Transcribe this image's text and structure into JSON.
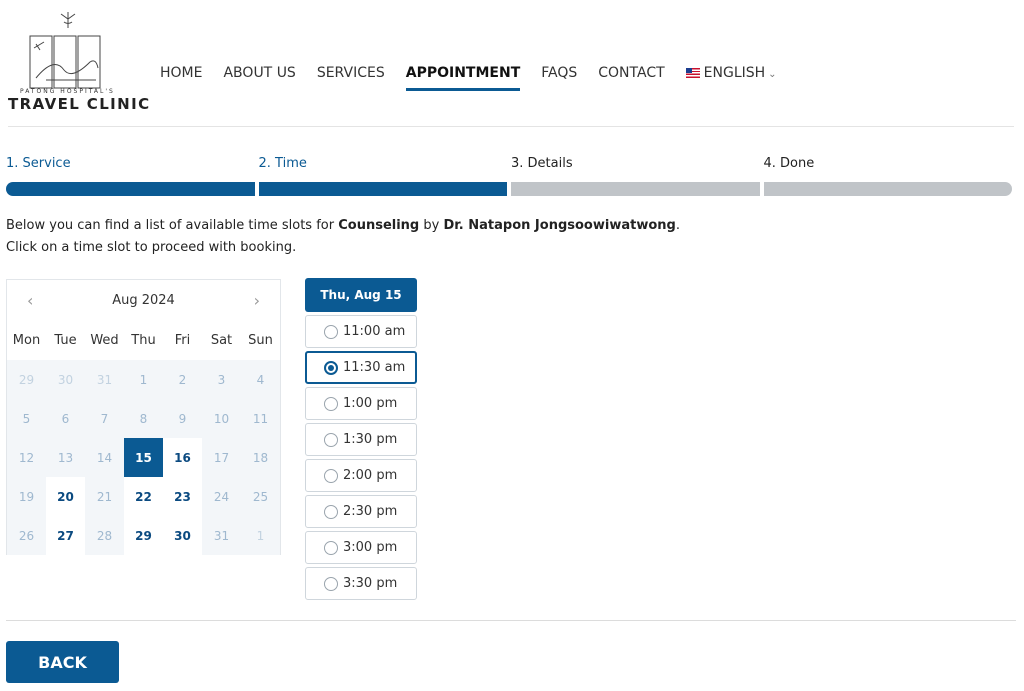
{
  "brand": {
    "small": "PATONG HOSPITAL'S",
    "name": "TRAVEL CLINIC"
  },
  "nav": {
    "items": [
      "HOME",
      "ABOUT US",
      "SERVICES",
      "APPOINTMENT",
      "FAQS",
      "CONTACT"
    ],
    "active": "APPOINTMENT",
    "language": "ENGLISH"
  },
  "steps": [
    {
      "label": "1. Service",
      "done": true
    },
    {
      "label": "2. Time",
      "done": true
    },
    {
      "label": "3. Details",
      "done": false
    },
    {
      "label": "4. Done",
      "done": false
    }
  ],
  "intro": {
    "line1_pre": "Below you can find a list of available time slots for ",
    "service": "Counseling",
    "by": " by ",
    "doctor": "Dr. Natapon Jongsoowiwatwong",
    "line1_post": ".",
    "line2": "Click on a time slot to proceed with booking."
  },
  "calendar": {
    "month": "Aug 2024",
    "weekdays": [
      "Mon",
      "Tue",
      "Wed",
      "Thu",
      "Fri",
      "Sat",
      "Sun"
    ],
    "days": [
      {
        "d": "29",
        "s": "other"
      },
      {
        "d": "30",
        "s": "other"
      },
      {
        "d": "31",
        "s": "other"
      },
      {
        "d": "1",
        "s": "off"
      },
      {
        "d": "2",
        "s": "off"
      },
      {
        "d": "3",
        "s": "off"
      },
      {
        "d": "4",
        "s": "off"
      },
      {
        "d": "5",
        "s": "off"
      },
      {
        "d": "6",
        "s": "off"
      },
      {
        "d": "7",
        "s": "off"
      },
      {
        "d": "8",
        "s": "off"
      },
      {
        "d": "9",
        "s": "off"
      },
      {
        "d": "10",
        "s": "off"
      },
      {
        "d": "11",
        "s": "off"
      },
      {
        "d": "12",
        "s": "off"
      },
      {
        "d": "13",
        "s": "off"
      },
      {
        "d": "14",
        "s": "off"
      },
      {
        "d": "15",
        "s": "selected"
      },
      {
        "d": "16",
        "s": "avail"
      },
      {
        "d": "17",
        "s": "off"
      },
      {
        "d": "18",
        "s": "off"
      },
      {
        "d": "19",
        "s": "off"
      },
      {
        "d": "20",
        "s": "avail"
      },
      {
        "d": "21",
        "s": "off"
      },
      {
        "d": "22",
        "s": "avail"
      },
      {
        "d": "23",
        "s": "avail"
      },
      {
        "d": "24",
        "s": "off"
      },
      {
        "d": "25",
        "s": "off"
      },
      {
        "d": "26",
        "s": "off"
      },
      {
        "d": "27",
        "s": "avail"
      },
      {
        "d": "28",
        "s": "off"
      },
      {
        "d": "29",
        "s": "avail"
      },
      {
        "d": "30",
        "s": "avail"
      },
      {
        "d": "31",
        "s": "off"
      },
      {
        "d": "1",
        "s": "other"
      }
    ]
  },
  "slots": {
    "header": "Thu, Aug 15",
    "times": [
      "11:00 am",
      "11:30 am",
      "1:00 pm",
      "1:30 pm",
      "2:00 pm",
      "2:30 pm",
      "3:00 pm",
      "3:30 pm"
    ],
    "selected": "11:30 am"
  },
  "back_label": "BACK",
  "colors": {
    "primary": "#0b5a93",
    "inactive_bar": "#c0c4c8",
    "available_day": "#0b4a80"
  }
}
